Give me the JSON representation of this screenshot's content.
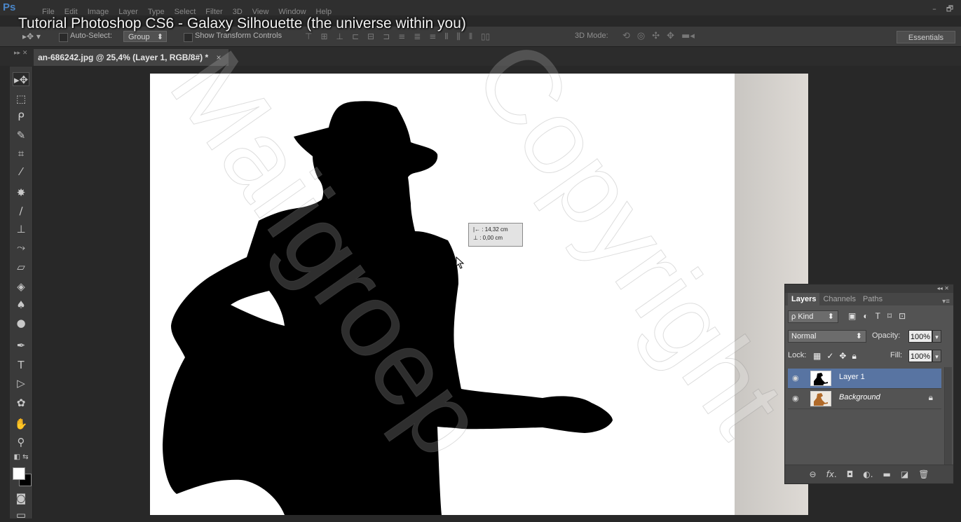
{
  "app": {
    "logo": "Ps",
    "menus": [
      "File",
      "Edit",
      "Image",
      "Layer",
      "Type",
      "Select",
      "Filter",
      "3D",
      "View",
      "Window",
      "Help"
    ]
  },
  "overlay_title": "Tutorial Photoshop CS6 - Galaxy Silhouette (the universe within you)",
  "window_controls": {
    "minimize": "–",
    "restore": "🗗"
  },
  "options": {
    "auto_select_label": "Auto-Select:",
    "group_value": "Group",
    "group_arrow": "⬍",
    "show_transform_label": "Show Transform Controls",
    "mode_3d_label": "3D Mode:",
    "workspace": "Essentials"
  },
  "document_tab": {
    "title": "an-686242.jpg @ 25,4% (Layer 1, RGB/8#) *",
    "close": "×"
  },
  "measure_tooltip": {
    "line1": "|← :  14,32 cm",
    "line2": "⊥ :    0,00 cm"
  },
  "layers_panel": {
    "tabs": [
      "Layers",
      "Channels",
      "Paths"
    ],
    "kind_label": "ρ Kind",
    "blend_mode": "Normal",
    "opacity_label": "Opacity:",
    "opacity_value": "100%",
    "lock_label": "Lock:",
    "fill_label": "Fill:",
    "fill_value": "100%",
    "layers": [
      {
        "name": "Layer 1",
        "selected": true,
        "locked": false
      },
      {
        "name": "Background",
        "selected": false,
        "locked": true
      }
    ],
    "footer_icons": [
      "link-icon",
      "fx-icon",
      "mask-icon",
      "adjustment-icon",
      "folder-icon",
      "new-layer-icon",
      "trash-icon"
    ]
  },
  "watermark": {
    "text1": "Maiigroep",
    "text2": "Copyright"
  }
}
